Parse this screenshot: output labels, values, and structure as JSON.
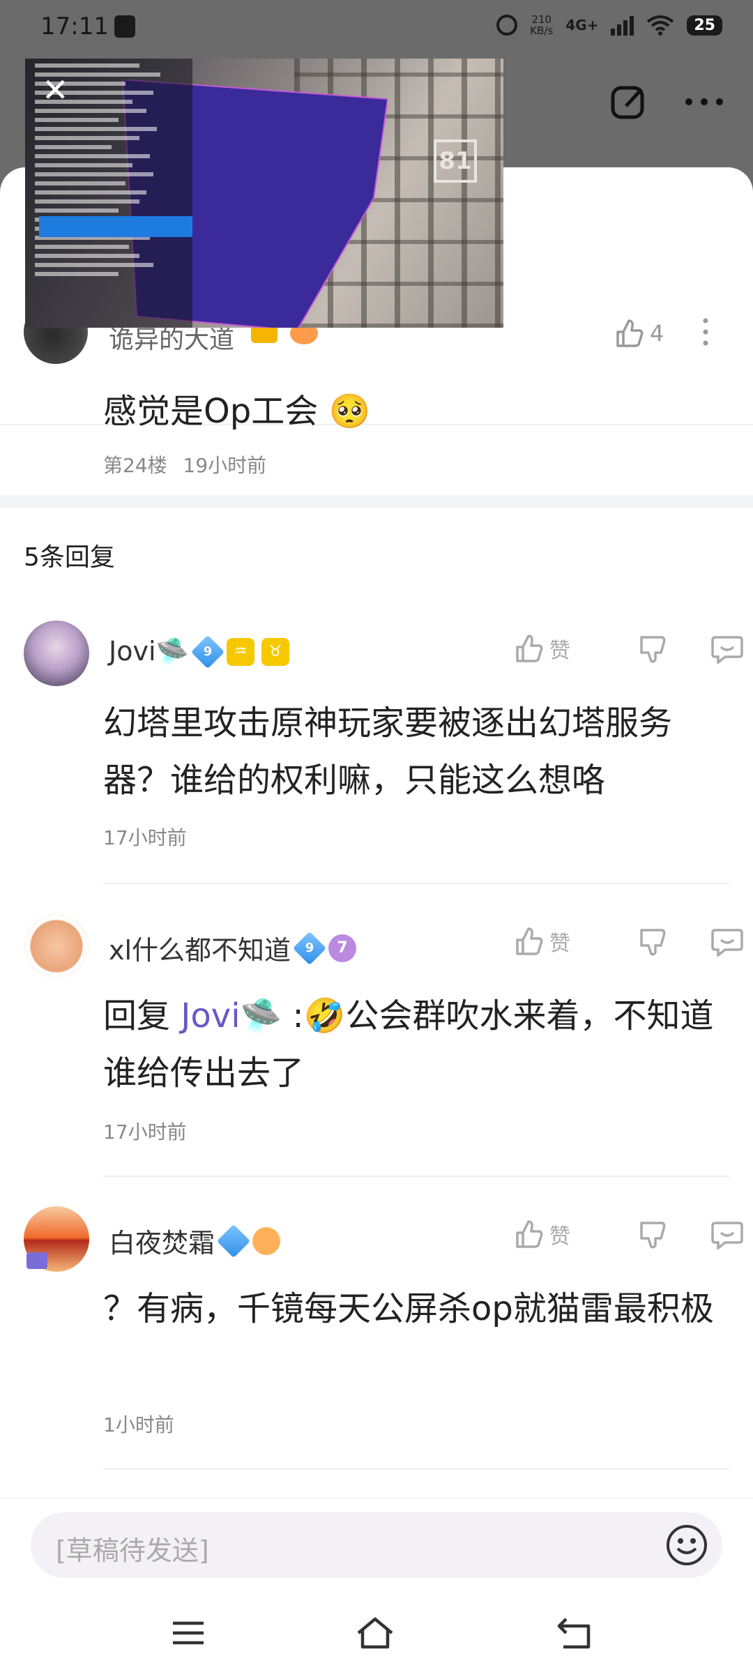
{
  "status_bar": {
    "time": "17:11",
    "net_speed_value": "210",
    "net_speed_unit": "KB/s",
    "signal": "4G+",
    "battery": "25"
  },
  "video": {
    "sign_text": "81"
  },
  "original_comment": {
    "author": "诡异的大道",
    "likes": "4",
    "text": "感觉是Op工会 🥺",
    "floor": "第24楼",
    "time": "19小时前"
  },
  "reply_count": "5条回复",
  "replies": [
    {
      "author": "Jovi🛸",
      "level": "9",
      "like_label": "赞",
      "text": "幻塔里攻击原神玩家要被逐出幻塔服务器？谁给的权利嘛，只能这么想咯",
      "time": "17小时前"
    },
    {
      "author": "xl什么都不知道",
      "level": "9",
      "badge": "7",
      "like_label": "赞",
      "reply_prefix": "回复 ",
      "mention": "Jovi🛸",
      "text": " :🤣公会群吹水来着，不知道谁给传出去了",
      "time": "17小时前"
    },
    {
      "author": "白夜焚霜",
      "like_label": "赞",
      "text": "？有病，千镜每天公屏杀op就猫雷最积极",
      "time": "1小时前"
    }
  ],
  "input": {
    "placeholder": "[草稿待发送]"
  },
  "colors": {
    "accent": "#6a58c8",
    "level_blue": "#2f8fe8",
    "sheet_bg": "#ffffff"
  }
}
